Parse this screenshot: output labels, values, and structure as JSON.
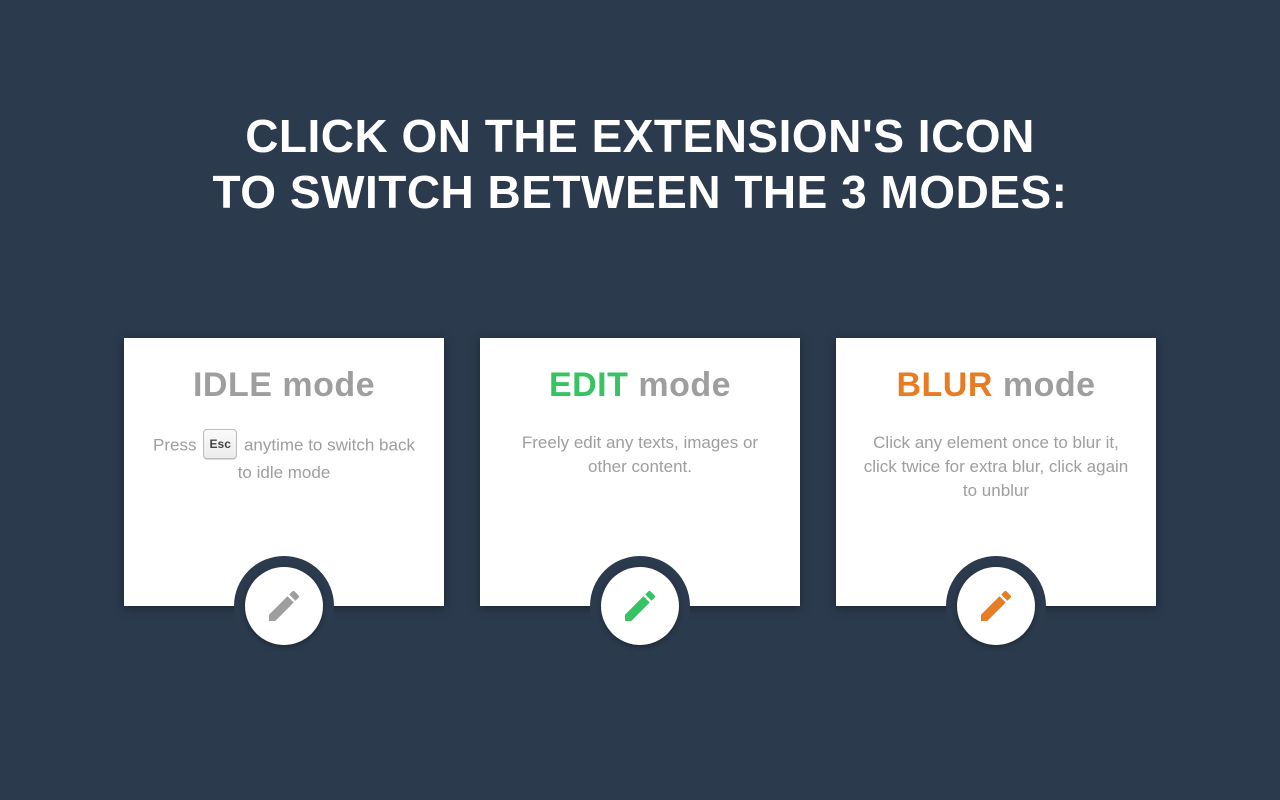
{
  "headline": {
    "line1": "CLICK ON THE EXTENSION'S ICON",
    "line2": "TO SWITCH BETWEEN THE 3 MODES:"
  },
  "cards": [
    {
      "title_accent": "IDLE",
      "title_rest": " mode",
      "accent_color": "#9e9e9e",
      "desc_before_key": "Press ",
      "key_label": "Esc",
      "desc_after_key": " anytime to switch back to idle mode",
      "has_key": true,
      "icon_color": "#9e9e9e"
    },
    {
      "title_accent": "EDIT",
      "title_rest": " mode",
      "accent_color": "#36c362",
      "desc": "Freely edit any texts, images or other content.",
      "has_key": false,
      "icon_color": "#36c362"
    },
    {
      "title_accent": "BLUR",
      "title_rest": " mode",
      "accent_color": "#e77c22",
      "desc": "Click any element once to blur it, click twice for extra blur, click again to unblur",
      "has_key": false,
      "icon_color": "#e77c22"
    }
  ]
}
